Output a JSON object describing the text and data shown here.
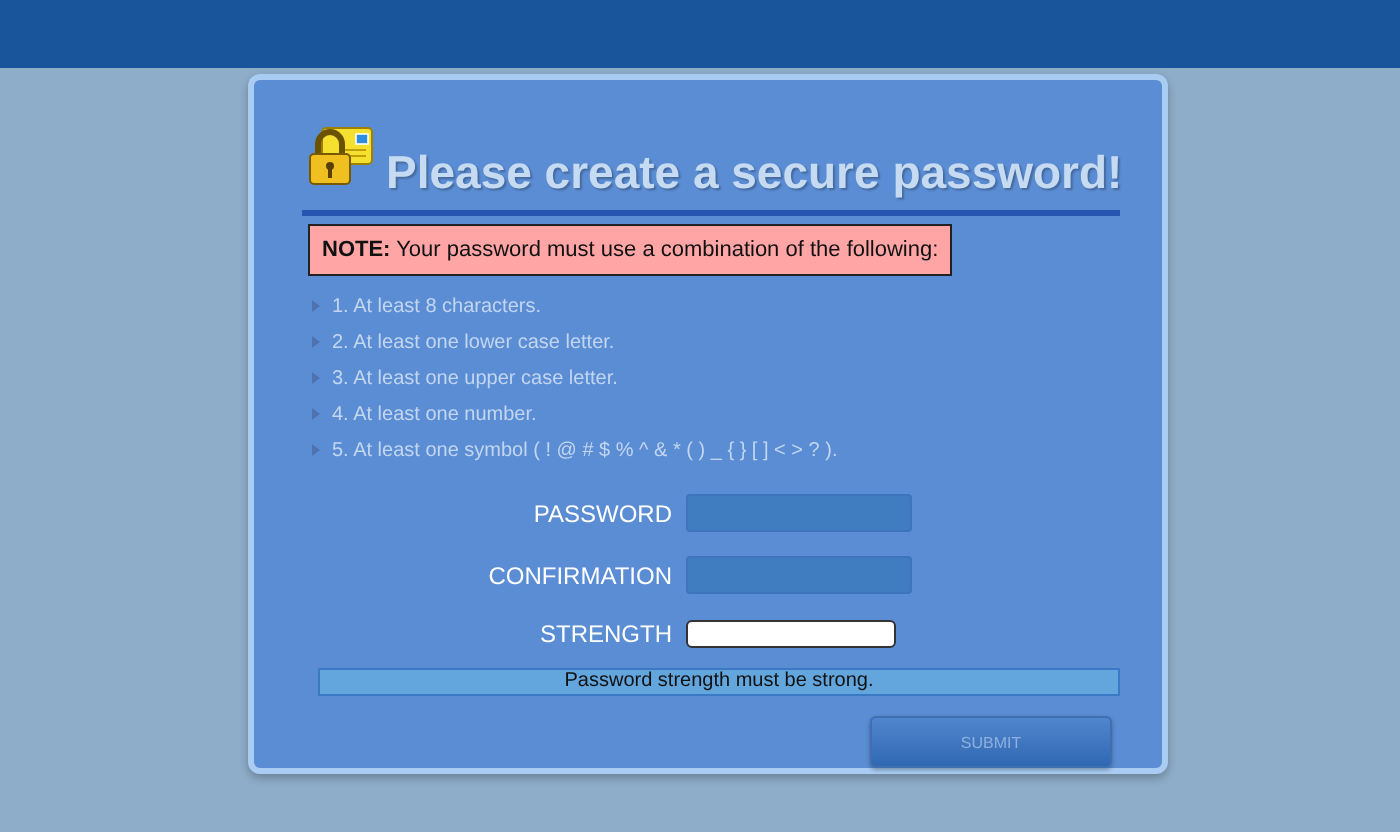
{
  "title": "Please create a secure password!",
  "note": {
    "label": "NOTE:",
    "text": "Your password must use a combination of the following:"
  },
  "rules": [
    "1. At least 8 characters.",
    "2. At least one lower case letter.",
    "3. At least one upper case letter.",
    "4. At least one number.",
    "5. At least one symbol ( ! @ # $ % ^ & * ( ) _ { } [ ] < > ? )."
  ],
  "fields": [
    {
      "label": "PASSWORD"
    },
    {
      "label": "CONFIRMATION"
    }
  ],
  "strength": {
    "label": "STRENGTH",
    "level": 0
  },
  "message": "Password strength must be strong.",
  "submit": {
    "label": "SUBMIT",
    "disabled": true
  }
}
